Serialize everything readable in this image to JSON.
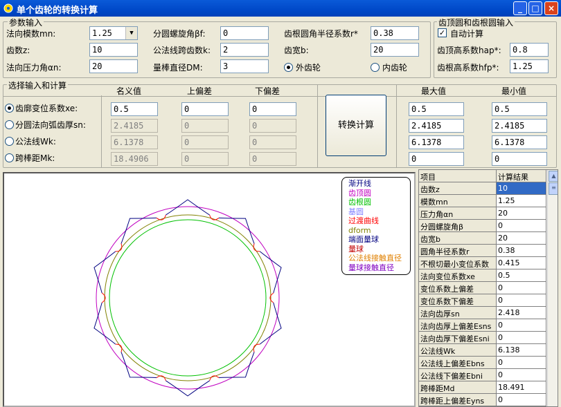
{
  "window": {
    "title": "单个齿轮的转换计算",
    "minimize": "_",
    "maximize": "□",
    "close": "×"
  },
  "params": {
    "group_label": "参数输入",
    "modulus_label": "法向模数mn:",
    "modulus_value": "1.25",
    "teeth_label": "齿数z:",
    "teeth_value": "10",
    "pressure_label": "法向压力角αn:",
    "pressure_value": "20",
    "helix_label": "分圆螺旋角βf:",
    "helix_value": "0",
    "span_teeth_label": "公法线跨齿数k:",
    "span_teeth_value": "2",
    "ball_label": "量棒直径DM:",
    "ball_value": "3",
    "fillet_label": "齿根圆角半径系数r*",
    "fillet_value": "0.38",
    "width_label": "齿宽b:",
    "width_value": "20",
    "external_label": "外齿轮",
    "internal_label": "内齿轮"
  },
  "addendum": {
    "group_label": "齿顶圆和齿根圆输入",
    "auto_label": "自动计算",
    "hap_label": "齿顶高系数hap*:",
    "hap_value": "0.8",
    "hfp_label": "齿根高系数hfp*:",
    "hfp_value": "1.25"
  },
  "calc": {
    "group_label": "选择输入和计算",
    "col_nominal": "名义值",
    "col_upper": "上偏差",
    "col_lower": "下偏差",
    "col_max": "最大值",
    "col_min": "最小值",
    "convert_button": "转换计算",
    "rows": [
      {
        "label": "齿廓变位系数xe:",
        "selected": true,
        "nominal": "0.5",
        "upper": "0",
        "lower": "0",
        "max": "0.5",
        "min": "0.5"
      },
      {
        "label": "分圆法向弧齿厚sn:",
        "selected": false,
        "nominal": "2.4185",
        "upper": "0",
        "lower": "0",
        "max": "2.4185",
        "min": "2.4185"
      },
      {
        "label": "公法线Wk:",
        "selected": false,
        "nominal": "6.1378",
        "upper": "0",
        "lower": "0",
        "max": "6.1378",
        "min": "6.1378"
      },
      {
        "label": "跨棒距Mk:",
        "selected": false,
        "nominal": "18.4906",
        "upper": "0",
        "lower": "0",
        "max": "0",
        "min": "0"
      }
    ]
  },
  "legend": [
    {
      "label": "渐开线",
      "color": "#000080"
    },
    {
      "label": "齿顶圆",
      "color": "#c000c0"
    },
    {
      "label": "齿根圆",
      "color": "#00c000"
    },
    {
      "label": "基圆",
      "color": "#8080ff"
    },
    {
      "label": "过渡曲线",
      "color": "#ff0000"
    },
    {
      "label": "dform",
      "color": "#808000"
    },
    {
      "label": "端面量球",
      "color": "#000080"
    },
    {
      "label": "量球",
      "color": "#c00000"
    },
    {
      "label": "公法线接触直径",
      "color": "#e08000"
    },
    {
      "label": "量球接触直径",
      "color": "#8000c0"
    }
  ],
  "results": {
    "col_item": "项目",
    "col_value": "计算结果",
    "rows": [
      {
        "item": "齿数z",
        "value": "10"
      },
      {
        "item": "模数mn",
        "value": "1.25"
      },
      {
        "item": "压力角αn",
        "value": "20"
      },
      {
        "item": "分圆螺旋角β",
        "value": "0"
      },
      {
        "item": "齿宽b",
        "value": "20"
      },
      {
        "item": "圆角半径系数r",
        "value": "0.38"
      },
      {
        "item": "不根切最小变位系数",
        "value": "0.415"
      },
      {
        "item": "法向变位系数xe",
        "value": "0.5"
      },
      {
        "item": "变位系数上偏差",
        "value": "0"
      },
      {
        "item": "变位系数下偏差",
        "value": "0"
      },
      {
        "item": "法向齿厚sn",
        "value": "2.418"
      },
      {
        "item": "法向齿厚上偏差Esns",
        "value": "0"
      },
      {
        "item": "法向齿厚下偏差Esni",
        "value": "0"
      },
      {
        "item": "公法线Wk",
        "value": "6.138"
      },
      {
        "item": "公法线上偏差Ebns",
        "value": "0"
      },
      {
        "item": "公法线下偏差Ebni",
        "value": "0"
      },
      {
        "item": "跨棒距Md",
        "value": "18.491"
      },
      {
        "item": "跨棒距上偏差Eyns",
        "value": "0"
      }
    ]
  }
}
